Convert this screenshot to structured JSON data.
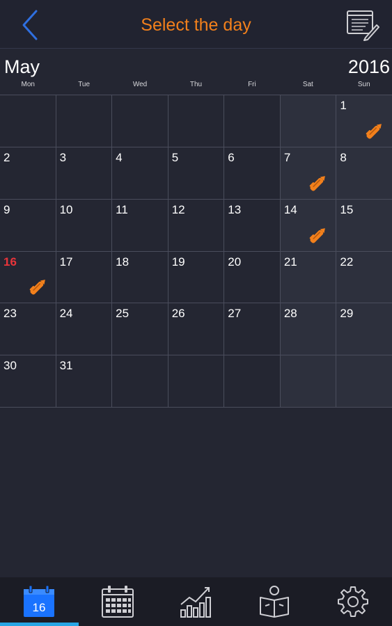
{
  "header": {
    "title": "Select the day",
    "back_icon": "chevron-left-icon",
    "notes_icon": "notes-edit-icon"
  },
  "month": "May",
  "year": "2016",
  "weekdays": [
    "Mon",
    "Tue",
    "Wed",
    "Thu",
    "Fri",
    "Sat",
    "Sun"
  ],
  "calendar": {
    "today": 16,
    "days_with_notes": [
      1,
      7,
      14,
      16
    ],
    "rows": [
      [
        "",
        "",
        "",
        "",
        "",
        "",
        "1"
      ],
      [
        "2",
        "3",
        "4",
        "5",
        "6",
        "7",
        "8"
      ],
      [
        "9",
        "10",
        "11",
        "12",
        "13",
        "14",
        "15"
      ],
      [
        "16",
        "17",
        "18",
        "19",
        "20",
        "21",
        "22"
      ],
      [
        "23",
        "24",
        "25",
        "26",
        "27",
        "28",
        "29"
      ],
      [
        "30",
        "31",
        "",
        "",
        "",
        "",
        ""
      ]
    ]
  },
  "tabbar": {
    "active_index": 0,
    "calendar_badge": "16",
    "tabs": [
      {
        "icon": "day-calendar-icon"
      },
      {
        "icon": "month-calendar-icon"
      },
      {
        "icon": "chart-icon"
      },
      {
        "icon": "reading-person-icon"
      },
      {
        "icon": "gear-icon"
      }
    ]
  },
  "colors": {
    "accent": "#f2801c",
    "today": "#e8343a",
    "back": "#2f6fe0",
    "active_tab": "#27a6e5",
    "tab_badge": "#1a73ff"
  }
}
